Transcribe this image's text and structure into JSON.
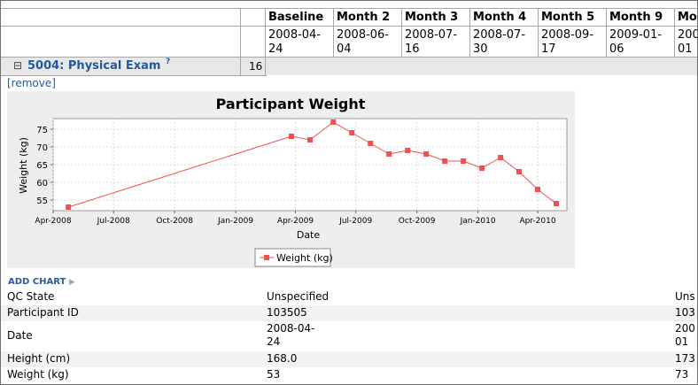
{
  "visits": [
    {
      "label": "Baseline",
      "date_line1": "2008-04-",
      "date_line2": "24"
    },
    {
      "label": "Month 2",
      "date_line1": "2008-06-",
      "date_line2": "04"
    },
    {
      "label": "Month 3",
      "date_line1": "2008-07-",
      "date_line2": "16"
    },
    {
      "label": "Month 4",
      "date_line1": "2008-07-",
      "date_line2": "30"
    },
    {
      "label": "Month 5",
      "date_line1": "2008-09-",
      "date_line2": "17"
    },
    {
      "label": "Month 9",
      "date_line1": "2009-01-",
      "date_line2": "06"
    },
    {
      "label": "Mor",
      "date_line1": "200",
      "date_line2": "01"
    }
  ],
  "dataset_row": {
    "collapse_symbol": "⊟",
    "title": "5004: Physical Exam",
    "help": "?",
    "count": "16"
  },
  "remove_link": "[remove]",
  "chart_data": {
    "type": "line",
    "title": "Participant Weight",
    "xlabel": "Date",
    "ylabel": "Weight (kg)",
    "x_ticks": [
      "Apr-2008",
      "Jul-2008",
      "Oct-2008",
      "Jan-2009",
      "Apr-2009",
      "Jul-2009",
      "Oct-2009",
      "Jan-2010",
      "Apr-2010"
    ],
    "y_ticks": [
      "55",
      "60",
      "65",
      "70",
      "75"
    ],
    "ylim": [
      52,
      78
    ],
    "xlim": [
      "2008-04-01",
      "2010-05-15"
    ],
    "grid": true,
    "legend_position": "bottom",
    "series_color": "#f05050",
    "series": [
      {
        "name": "Weight (kg)",
        "x": [
          "2008-04-24",
          "2009-03-26",
          "2009-04-23",
          "2009-05-28",
          "2009-06-25",
          "2009-07-23",
          "2009-08-20",
          "2009-09-17",
          "2009-10-15",
          "2009-11-12",
          "2009-12-10",
          "2010-01-07",
          "2010-02-04",
          "2010-03-04",
          "2010-04-01",
          "2010-04-29"
        ],
        "y": [
          53,
          73,
          72,
          77,
          74,
          71,
          68,
          69,
          68,
          66,
          66,
          64,
          67,
          63,
          58,
          54
        ]
      }
    ]
  },
  "add_chart": "ADD CHART",
  "properties": [
    {
      "label": "QC State",
      "value": "Unspecified",
      "value2": "Uns"
    },
    {
      "label": "Participant ID",
      "value": "103505",
      "value2": "103"
    },
    {
      "label": "Date",
      "value": "2008-04-\n24",
      "value2": "200\n01"
    },
    {
      "label": "Height (cm)",
      "value": "168.0",
      "value2": "173"
    },
    {
      "label": "Weight (kg)",
      "value": "53",
      "value2": "73"
    }
  ]
}
